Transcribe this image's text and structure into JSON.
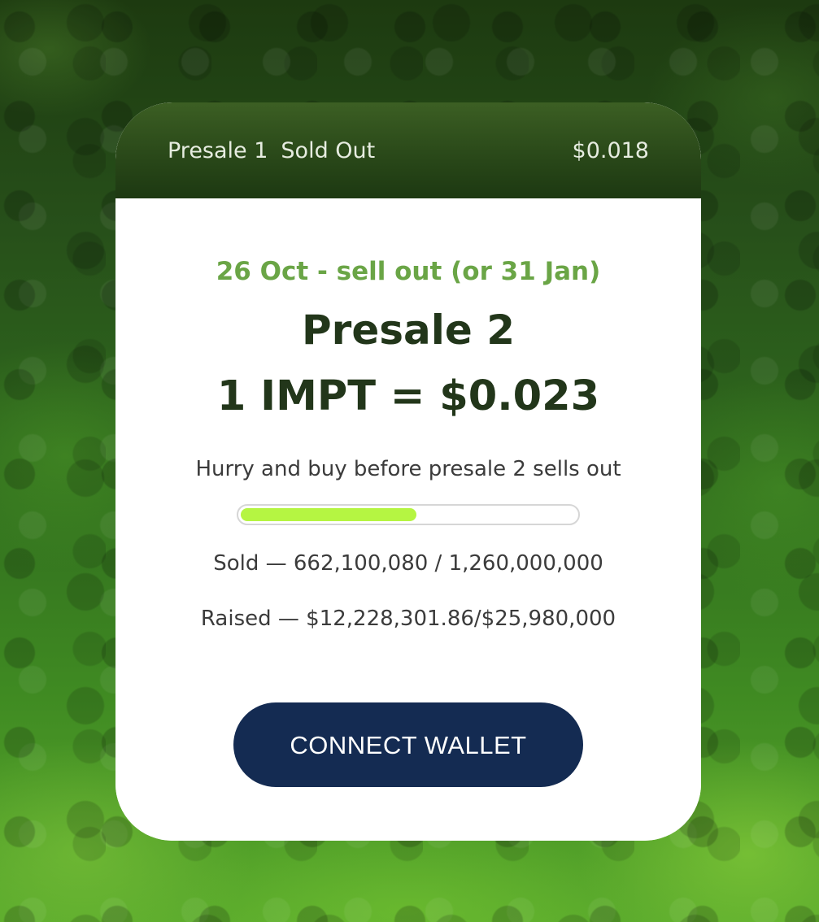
{
  "header": {
    "stage_label": "Presale 1",
    "status": "Sold Out",
    "price": "$0.018"
  },
  "main": {
    "dates": "26 Oct - sell out (or 31 Jan)",
    "title": "Presale 2",
    "price_line": "1 IMPT = $0.023",
    "subtitle": "Hurry and buy before presale 2 sells out",
    "progress_fraction": 0.525,
    "sold": "Sold — 662,100,080 / 1,260,000,000",
    "raised": "Raised — $12,228,301.86/$25,980,000",
    "connect_label": "CONNECT WALLET"
  },
  "colors": {
    "accent_green": "#6aa546",
    "progress_fill": "#b5f542",
    "button_bg": "#142b52",
    "heading": "#22361a"
  }
}
